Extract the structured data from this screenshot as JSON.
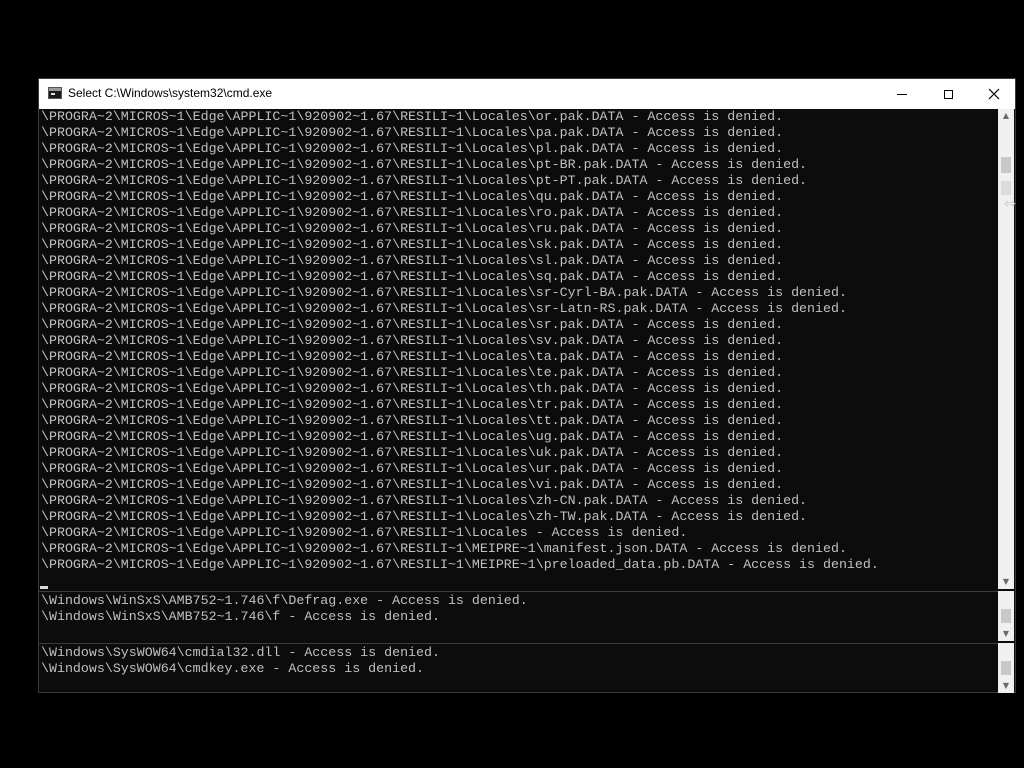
{
  "window": {
    "title": "Select C:\\Windows\\system32\\cmd.exe",
    "minimize_glyph": "minimize",
    "maximize_glyph": "maximize",
    "close_glyph": "✕"
  },
  "console": {
    "main_lines": [
      "\\PROGRA~2\\MICROS~1\\Edge\\APPLIC~1\\920902~1.67\\RESILI~1\\Locales\\or.pak.DATA - Access is denied.",
      "\\PROGRA~2\\MICROS~1\\Edge\\APPLIC~1\\920902~1.67\\RESILI~1\\Locales\\pa.pak.DATA - Access is denied.",
      "\\PROGRA~2\\MICROS~1\\Edge\\APPLIC~1\\920902~1.67\\RESILI~1\\Locales\\pl.pak.DATA - Access is denied.",
      "\\PROGRA~2\\MICROS~1\\Edge\\APPLIC~1\\920902~1.67\\RESILI~1\\Locales\\pt-BR.pak.DATA - Access is denied.",
      "\\PROGRA~2\\MICROS~1\\Edge\\APPLIC~1\\920902~1.67\\RESILI~1\\Locales\\pt-PT.pak.DATA - Access is denied.",
      "\\PROGRA~2\\MICROS~1\\Edge\\APPLIC~1\\920902~1.67\\RESILI~1\\Locales\\qu.pak.DATA - Access is denied.",
      "\\PROGRA~2\\MICROS~1\\Edge\\APPLIC~1\\920902~1.67\\RESILI~1\\Locales\\ro.pak.DATA - Access is denied.",
      "\\PROGRA~2\\MICROS~1\\Edge\\APPLIC~1\\920902~1.67\\RESILI~1\\Locales\\ru.pak.DATA - Access is denied.",
      "\\PROGRA~2\\MICROS~1\\Edge\\APPLIC~1\\920902~1.67\\RESILI~1\\Locales\\sk.pak.DATA - Access is denied.",
      "\\PROGRA~2\\MICROS~1\\Edge\\APPLIC~1\\920902~1.67\\RESILI~1\\Locales\\sl.pak.DATA - Access is denied.",
      "\\PROGRA~2\\MICROS~1\\Edge\\APPLIC~1\\920902~1.67\\RESILI~1\\Locales\\sq.pak.DATA - Access is denied.",
      "\\PROGRA~2\\MICROS~1\\Edge\\APPLIC~1\\920902~1.67\\RESILI~1\\Locales\\sr-Cyrl-BA.pak.DATA - Access is denied.",
      "\\PROGRA~2\\MICROS~1\\Edge\\APPLIC~1\\920902~1.67\\RESILI~1\\Locales\\sr-Latn-RS.pak.DATA - Access is denied.",
      "\\PROGRA~2\\MICROS~1\\Edge\\APPLIC~1\\920902~1.67\\RESILI~1\\Locales\\sr.pak.DATA - Access is denied.",
      "\\PROGRA~2\\MICROS~1\\Edge\\APPLIC~1\\920902~1.67\\RESILI~1\\Locales\\sv.pak.DATA - Access is denied.",
      "\\PROGRA~2\\MICROS~1\\Edge\\APPLIC~1\\920902~1.67\\RESILI~1\\Locales\\ta.pak.DATA - Access is denied.",
      "\\PROGRA~2\\MICROS~1\\Edge\\APPLIC~1\\920902~1.67\\RESILI~1\\Locales\\te.pak.DATA - Access is denied.",
      "\\PROGRA~2\\MICROS~1\\Edge\\APPLIC~1\\920902~1.67\\RESILI~1\\Locales\\th.pak.DATA - Access is denied.",
      "\\PROGRA~2\\MICROS~1\\Edge\\APPLIC~1\\920902~1.67\\RESILI~1\\Locales\\tr.pak.DATA - Access is denied.",
      "\\PROGRA~2\\MICROS~1\\Edge\\APPLIC~1\\920902~1.67\\RESILI~1\\Locales\\tt.pak.DATA - Access is denied.",
      "\\PROGRA~2\\MICROS~1\\Edge\\APPLIC~1\\920902~1.67\\RESILI~1\\Locales\\ug.pak.DATA - Access is denied.",
      "\\PROGRA~2\\MICROS~1\\Edge\\APPLIC~1\\920902~1.67\\RESILI~1\\Locales\\uk.pak.DATA - Access is denied.",
      "\\PROGRA~2\\MICROS~1\\Edge\\APPLIC~1\\920902~1.67\\RESILI~1\\Locales\\ur.pak.DATA - Access is denied.",
      "\\PROGRA~2\\MICROS~1\\Edge\\APPLIC~1\\920902~1.67\\RESILI~1\\Locales\\vi.pak.DATA - Access is denied.",
      "\\PROGRA~2\\MICROS~1\\Edge\\APPLIC~1\\920902~1.67\\RESILI~1\\Locales\\zh-CN.pak.DATA - Access is denied.",
      "\\PROGRA~2\\MICROS~1\\Edge\\APPLIC~1\\920902~1.67\\RESILI~1\\Locales\\zh-TW.pak.DATA - Access is denied.",
      "\\PROGRA~2\\MICROS~1\\Edge\\APPLIC~1\\920902~1.67\\RESILI~1\\Locales - Access is denied.",
      "\\PROGRA~2\\MICROS~1\\Edge\\APPLIC~1\\920902~1.67\\RESILI~1\\MEIPRE~1\\manifest.json.DATA - Access is denied.",
      "\\PROGRA~2\\MICROS~1\\Edge\\APPLIC~1\\920902~1.67\\RESILI~1\\MEIPRE~1\\preloaded_data.pb.DATA - Access is denied."
    ],
    "pane_b_lines": [
      "\\Windows\\WinSxS\\AMB752~1.746\\f\\Defrag.exe - Access is denied.",
      "\\Windows\\WinSxS\\AMB752~1.746\\f - Access is denied."
    ],
    "pane_c_lines": [
      "\\Windows\\SysWOW64\\cmdial32.dll - Access is denied.",
      "\\Windows\\SysWOW64\\cmdkey.exe - Access is denied."
    ]
  },
  "scrollbars": {
    "up_glyph": "▲",
    "down_glyph": "▼"
  },
  "pointer": {
    "glyph": "⇔"
  }
}
